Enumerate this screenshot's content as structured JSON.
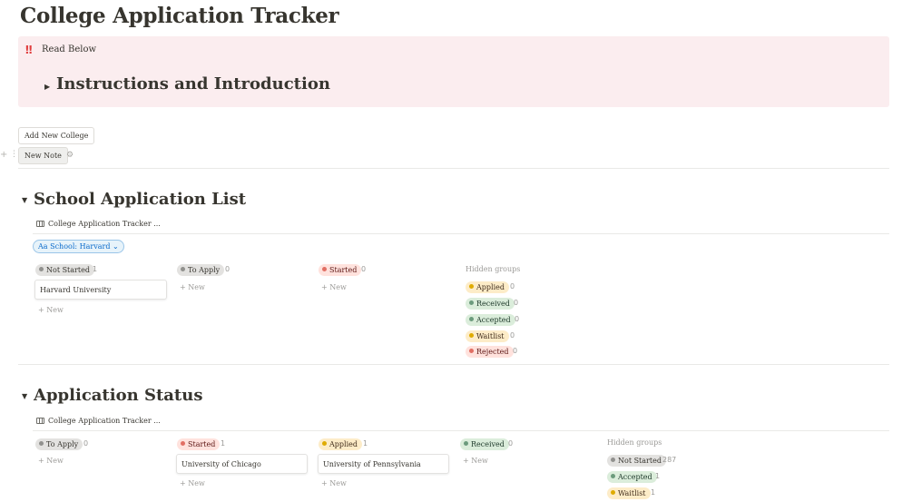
{
  "page": {
    "title": "College Application Tracker"
  },
  "callout": {
    "icon": "‼",
    "icon_name": "double-exclamation-icon",
    "text": "Read Below",
    "toggle_heading": "Instructions and Introduction"
  },
  "buttons": {
    "add_college": "Add New College",
    "new_note": "New Note"
  },
  "sections": [
    {
      "title": "School Application List",
      "database_title": "College Application Tracker ...",
      "filter": "Aa School: Harvard ⌄",
      "groups": [
        {
          "name": "Not Started",
          "color": "gray",
          "count": "1",
          "cards": [
            "Harvard University"
          ],
          "new_label": "+ New"
        },
        {
          "name": "To Apply",
          "color": "gray",
          "count": "0",
          "cards": [],
          "new_label": "+ New"
        },
        {
          "name": "Started",
          "color": "red",
          "count": "0",
          "cards": [],
          "new_label": "+ New"
        }
      ],
      "hidden_label": "Hidden groups",
      "hidden_groups": [
        {
          "name": "Applied",
          "color": "yellow",
          "count": "0"
        },
        {
          "name": "Received",
          "color": "green",
          "count": "0"
        },
        {
          "name": "Accepted",
          "color": "green",
          "count": "0"
        },
        {
          "name": "Waitlist",
          "color": "yellow",
          "count": "0"
        },
        {
          "name": "Rejected",
          "color": "red",
          "count": "0"
        }
      ]
    },
    {
      "title": "Application Status",
      "database_title": "College Application Tracker ...",
      "groups": [
        {
          "name": "To Apply",
          "color": "gray",
          "count": "0",
          "cards": [],
          "new_label": "+ New"
        },
        {
          "name": "Started",
          "color": "red",
          "count": "1",
          "cards": [
            "University of Chicago"
          ],
          "new_label": "+ New"
        },
        {
          "name": "Applied",
          "color": "yellow",
          "count": "1",
          "cards": [
            "University of Pennsylvania"
          ],
          "new_label": "+ New"
        },
        {
          "name": "Received",
          "color": "green",
          "count": "0",
          "cards": [],
          "new_label": "+ New"
        }
      ],
      "hidden_label": "Hidden groups",
      "hidden_groups": [
        {
          "name": "Not Started",
          "color": "gray",
          "count": "287"
        },
        {
          "name": "Accepted",
          "color": "green",
          "count": "1"
        },
        {
          "name": "Waitlist",
          "color": "yellow",
          "count": "1"
        }
      ]
    }
  ],
  "colors": {
    "callout_bg": "#fbedef",
    "gray_tag": "#e3e2e0",
    "red_tag": "#ffe2dd",
    "yellow_tag": "#fdecc8",
    "green_tag": "#dbeddb",
    "filter_blue": "#0b6bcb"
  }
}
